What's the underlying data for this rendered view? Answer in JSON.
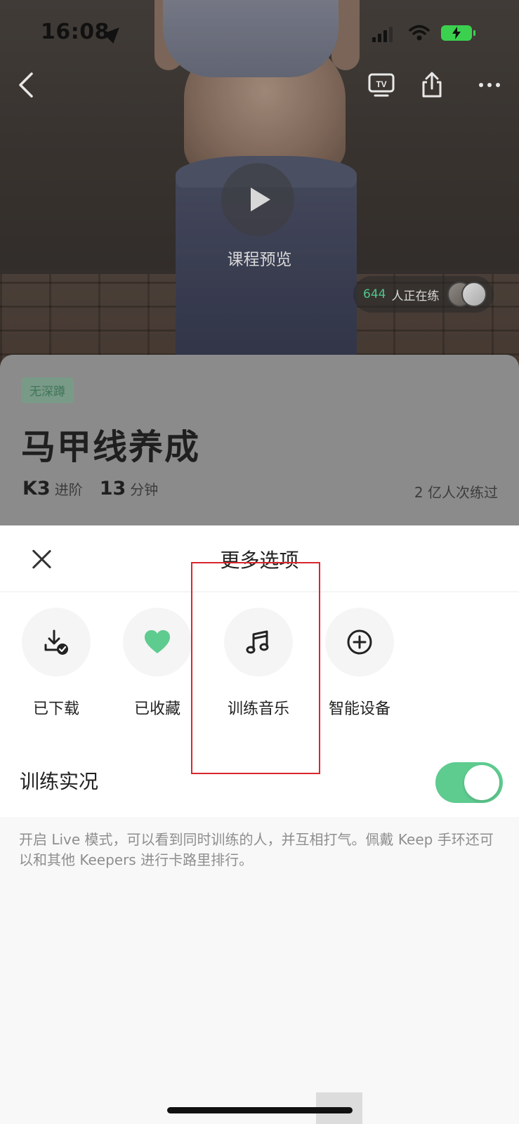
{
  "status_bar": {
    "time": "16:08"
  },
  "hero": {
    "preview_label": "课程预览",
    "live_count": "644",
    "live_text": "人正在练"
  },
  "course": {
    "tag": "无深蹲",
    "title": "马甲线养成",
    "level_num": "K3",
    "level_unit": "进阶",
    "duration_num": "13",
    "duration_unit": "分钟",
    "participants": "2 亿人次练过"
  },
  "sheet": {
    "title": "更多选项",
    "options": [
      {
        "label": "已下载",
        "icon": "download-done-icon"
      },
      {
        "label": "已收藏",
        "icon": "heart-icon"
      },
      {
        "label": "训练音乐",
        "icon": "music-note-icon"
      },
      {
        "label": "智能设备",
        "icon": "plus-circle-icon"
      }
    ],
    "live_label": "训练实况",
    "live_enabled": true,
    "live_description": "开启 Live 模式，可以看到同时训练的人，并互相打气。佩戴 Keep 手环还可以和其他 Keepers 进行卡路里排行。"
  },
  "colors": {
    "accent_green": "#5ecb8f",
    "highlight_red": "#d8262c",
    "live_count_green": "#4ec58c"
  }
}
